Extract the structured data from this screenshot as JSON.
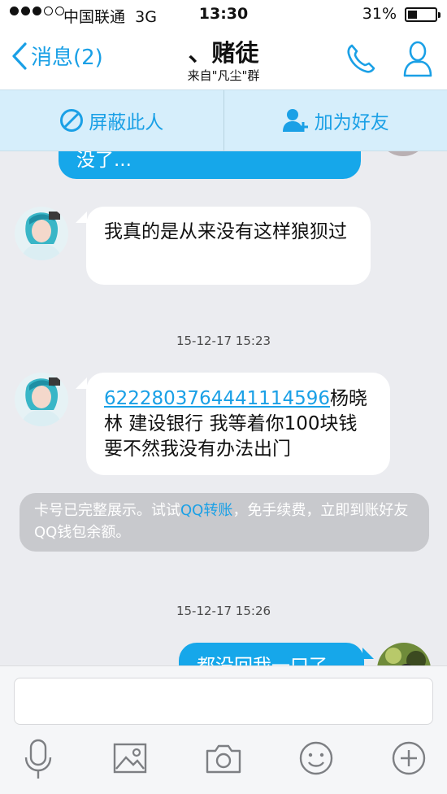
{
  "status_bar": {
    "carrier": "中国联通",
    "network": "3G",
    "time": "13:30",
    "battery": "31%"
  },
  "nav": {
    "back_label": "消息(2)",
    "title": "、赌徒",
    "subtitle": "来自\"凡尘\"群"
  },
  "actions": {
    "block_label": "屏蔽此人",
    "add_friend_label": "加为好友"
  },
  "messages": {
    "partial_top": "没了...",
    "msg1": "我真的是从来没有这样狼狈过",
    "timestamp1": "15-12-17 15:23",
    "msg2_card": "6222803764441114596",
    "msg2_rest": "杨晓林  建设银行   我等着你100块钱   要不然我没有办法出门",
    "system_pre": "卡号已完整展示。试试",
    "system_link": "QQ转账",
    "system_post": "，免手续费，立即到账好友QQ钱包余额。",
    "timestamp2": "15-12-17 15:26",
    "partial_bottom": "都没回我一口了"
  },
  "colors": {
    "accent": "#1aa0e6",
    "bubble_out": "#16a7ea",
    "background": "#ebecf0",
    "action_bar": "#d6eefb"
  },
  "icons": {
    "back": "chevron-left-icon",
    "phone": "phone-icon",
    "profile": "person-icon",
    "block": "block-icon",
    "add_friend": "add-person-icon",
    "mic": "microphone-icon",
    "image": "image-icon",
    "camera": "camera-icon",
    "emoji": "emoji-icon",
    "plus": "plus-icon"
  }
}
